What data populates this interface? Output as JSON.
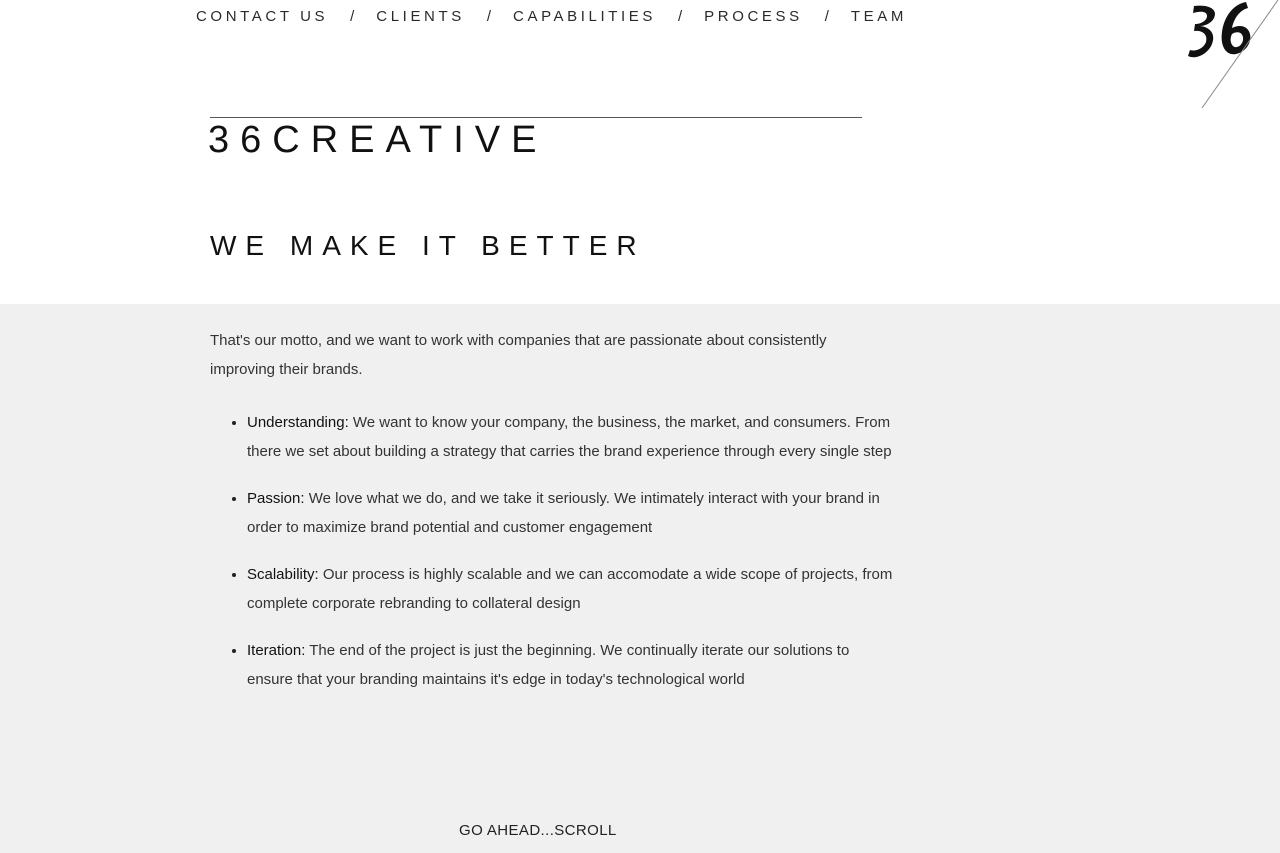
{
  "nav": {
    "items": [
      {
        "label": "CONTACT US"
      },
      {
        "label": "CLIENTS"
      },
      {
        "label": "CAPABILITIES"
      },
      {
        "label": "PROCESS"
      },
      {
        "label": "TEAM"
      }
    ],
    "separator": "/"
  },
  "logo": {
    "icon": "36-logo-icon"
  },
  "brand": {
    "title": "36CREATIVE"
  },
  "hero": {
    "motto": "WE MAKE IT BETTER"
  },
  "content": {
    "intro": "That's our motto, and we want to work with companies that are passionate about consistently improving their brands.",
    "values": [
      {
        "term": "Understanding:",
        "text": " We want to know your company, the business, the market, and consumers. From there we set about building a strategy that carries the brand experience through every single step"
      },
      {
        "term": "Passion:",
        "text": " We love what we do, and we take it seriously. We intimately interact with your brand in order to maximize brand potential and customer engagement"
      },
      {
        "term": "Scalability:",
        "text": " Our process is highly scalable and we can accomodate a wide scope of projects, from complete corporate rebranding to collateral design"
      },
      {
        "term": "Iteration:",
        "text": " The end of the project is just the beginning. We continually iterate our solutions to ensure that your branding maintains it's edge in today's technological world"
      }
    ],
    "scroll_cta": "GO AHEAD...SCROLL"
  },
  "colors": {
    "background": "#ffffff",
    "section_grey": "#f0f0f0",
    "text": "#1a1a1a"
  }
}
